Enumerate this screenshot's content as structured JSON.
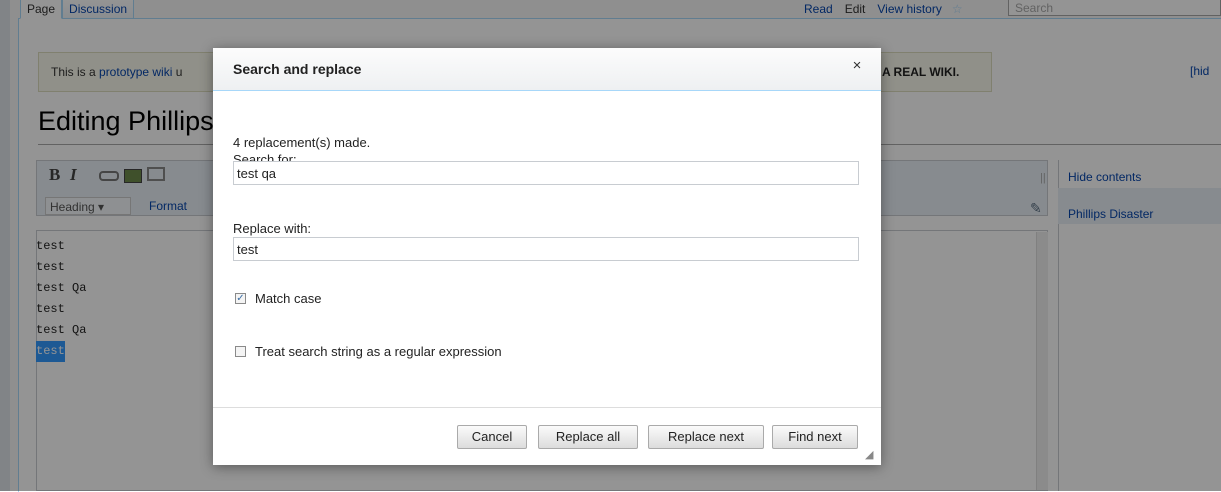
{
  "wiki": {
    "tabs_left": [
      "Page",
      "Discussion"
    ],
    "tabs_right": [
      "Read",
      "Edit",
      "View history"
    ],
    "search_placeholder": "Search",
    "notice_prefix": "This is a ",
    "notice_link": "prototype wiki",
    "notice_suffix": " u",
    "notice_right": "A REAL WIKI.",
    "hide_link": "[hid",
    "page_heading": "Editing Phillips",
    "toolbar": {
      "bold": "B",
      "italic": "I",
      "heading_select": "Heading",
      "format_link": "Format"
    },
    "toc": {
      "grip": "||",
      "hide_contents": "Hide contents",
      "item": "Phillips Disaster"
    },
    "editor_lines": [
      "test",
      "test",
      "test Qa",
      "test",
      "test Qa",
      "test"
    ]
  },
  "dialog": {
    "title": "Search and replace",
    "close_label": "×",
    "status": "4 replacement(s) made.",
    "search_label": "Search for:",
    "search_value": "test qa",
    "replace_label": "Replace with:",
    "replace_value": "test",
    "match_case_label": "Match case",
    "match_case_checked": true,
    "regex_label": "Treat search string as a regular expression",
    "regex_checked": false,
    "buttons": {
      "cancel": "Cancel",
      "replace_all": "Replace all",
      "replace_next": "Replace next",
      "find_next": "Find next"
    }
  }
}
